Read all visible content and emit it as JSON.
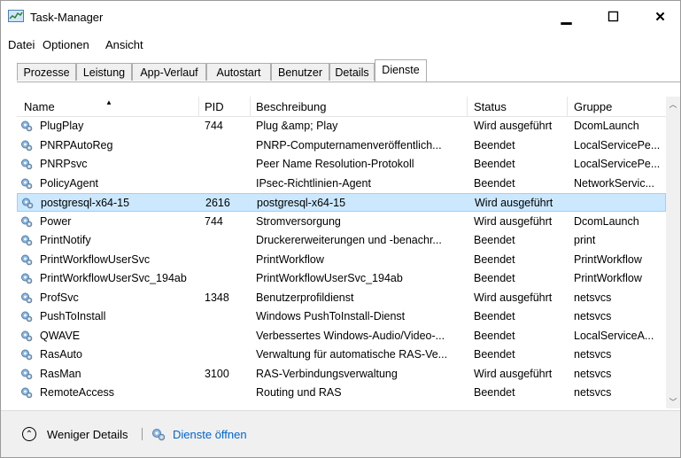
{
  "window": {
    "title": "Task-Manager",
    "minimize": "▁",
    "maximize": "☐",
    "close": "✕"
  },
  "menu": [
    "Datei",
    "Optionen",
    "Ansicht"
  ],
  "tabs": [
    "Prozesse",
    "Leistung",
    "App-Verlauf",
    "Autostart",
    "Benutzer",
    "Details",
    "Dienste"
  ],
  "active_tab": "Dienste",
  "columns": [
    "Name",
    "PID",
    "Beschreibung",
    "Status",
    "Gruppe"
  ],
  "services": [
    {
      "name": "PlugPlay",
      "pid": "744",
      "description": "Plug &amp; Play",
      "status": "Wird ausgeführt",
      "group": "DcomLaunch"
    },
    {
      "name": "PNRPAutoReg",
      "pid": "",
      "description": "PNRP-Computernamenveröffentlich...",
      "status": "Beendet",
      "group": "LocalServicePe..."
    },
    {
      "name": "PNRPsvc",
      "pid": "",
      "description": "Peer Name Resolution-Protokoll",
      "status": "Beendet",
      "group": "LocalServicePe..."
    },
    {
      "name": "PolicyAgent",
      "pid": "",
      "description": "IPsec-Richtlinien-Agent",
      "status": "Beendet",
      "group": "NetworkServic..."
    },
    {
      "name": "postgresql-x64-15",
      "pid": "2616",
      "description": "postgresql-x64-15",
      "status": "Wird ausgeführt",
      "group": ""
    },
    {
      "name": "Power",
      "pid": "744",
      "description": "Stromversorgung",
      "status": "Wird ausgeführt",
      "group": "DcomLaunch"
    },
    {
      "name": "PrintNotify",
      "pid": "",
      "description": "Druckererweiterungen und -benachr...",
      "status": "Beendet",
      "group": "print"
    },
    {
      "name": "PrintWorkflowUserSvc",
      "pid": "",
      "description": "PrintWorkflow",
      "status": "Beendet",
      "group": "PrintWorkflow"
    },
    {
      "name": "PrintWorkflowUserSvc_194ab",
      "pid": "",
      "description": "PrintWorkflowUserSvc_194ab",
      "status": "Beendet",
      "group": "PrintWorkflow"
    },
    {
      "name": "ProfSvc",
      "pid": "1348",
      "description": "Benutzerprofildienst",
      "status": "Wird ausgeführt",
      "group": "netsvcs"
    },
    {
      "name": "PushToInstall",
      "pid": "",
      "description": "Windows PushToInstall-Dienst",
      "status": "Beendet",
      "group": "netsvcs"
    },
    {
      "name": "QWAVE",
      "pid": "",
      "description": "Verbessertes Windows-Audio/Video-...",
      "status": "Beendet",
      "group": "LocalServiceA..."
    },
    {
      "name": "RasAuto",
      "pid": "",
      "description": "Verwaltung für automatische RAS-Ve...",
      "status": "Beendet",
      "group": "netsvcs"
    },
    {
      "name": "RasMan",
      "pid": "3100",
      "description": "RAS-Verbindungsverwaltung",
      "status": "Wird ausgeführt",
      "group": "netsvcs"
    },
    {
      "name": "RemoteAccess",
      "pid": "",
      "description": "Routing und RAS",
      "status": "Beendet",
      "group": "netsvcs"
    }
  ],
  "selected_service": "postgresql-x64-15",
  "footer": {
    "less_details": "Weniger Details",
    "open_services": "Dienste öffnen"
  },
  "colors": {
    "selection_bg": "#cce8ff",
    "selection_border": "#99d1ff",
    "link": "#0066cc",
    "close_hover": "#e81123"
  }
}
